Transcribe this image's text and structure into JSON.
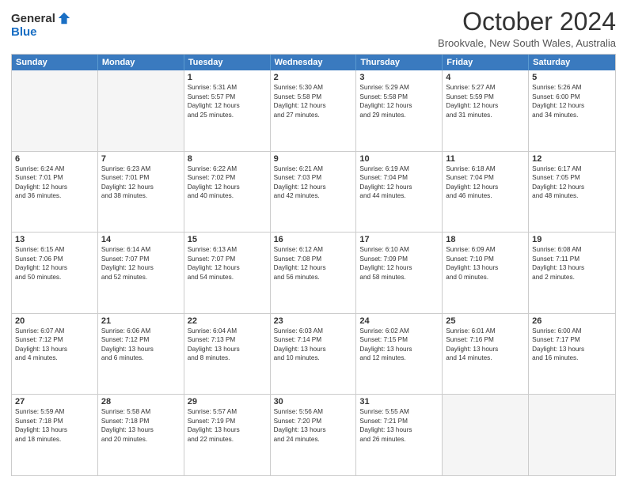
{
  "header": {
    "logo_general": "General",
    "logo_blue": "Blue",
    "title": "October 2024",
    "subtitle": "Brookvale, New South Wales, Australia"
  },
  "days_of_week": [
    "Sunday",
    "Monday",
    "Tuesday",
    "Wednesday",
    "Thursday",
    "Friday",
    "Saturday"
  ],
  "weeks": [
    [
      {
        "day": "",
        "lines": []
      },
      {
        "day": "",
        "lines": []
      },
      {
        "day": "1",
        "lines": [
          "Sunrise: 5:31 AM",
          "Sunset: 5:57 PM",
          "Daylight: 12 hours",
          "and 25 minutes."
        ]
      },
      {
        "day": "2",
        "lines": [
          "Sunrise: 5:30 AM",
          "Sunset: 5:58 PM",
          "Daylight: 12 hours",
          "and 27 minutes."
        ]
      },
      {
        "day": "3",
        "lines": [
          "Sunrise: 5:29 AM",
          "Sunset: 5:58 PM",
          "Daylight: 12 hours",
          "and 29 minutes."
        ]
      },
      {
        "day": "4",
        "lines": [
          "Sunrise: 5:27 AM",
          "Sunset: 5:59 PM",
          "Daylight: 12 hours",
          "and 31 minutes."
        ]
      },
      {
        "day": "5",
        "lines": [
          "Sunrise: 5:26 AM",
          "Sunset: 6:00 PM",
          "Daylight: 12 hours",
          "and 34 minutes."
        ]
      }
    ],
    [
      {
        "day": "6",
        "lines": [
          "Sunrise: 6:24 AM",
          "Sunset: 7:01 PM",
          "Daylight: 12 hours",
          "and 36 minutes."
        ]
      },
      {
        "day": "7",
        "lines": [
          "Sunrise: 6:23 AM",
          "Sunset: 7:01 PM",
          "Daylight: 12 hours",
          "and 38 minutes."
        ]
      },
      {
        "day": "8",
        "lines": [
          "Sunrise: 6:22 AM",
          "Sunset: 7:02 PM",
          "Daylight: 12 hours",
          "and 40 minutes."
        ]
      },
      {
        "day": "9",
        "lines": [
          "Sunrise: 6:21 AM",
          "Sunset: 7:03 PM",
          "Daylight: 12 hours",
          "and 42 minutes."
        ]
      },
      {
        "day": "10",
        "lines": [
          "Sunrise: 6:19 AM",
          "Sunset: 7:04 PM",
          "Daylight: 12 hours",
          "and 44 minutes."
        ]
      },
      {
        "day": "11",
        "lines": [
          "Sunrise: 6:18 AM",
          "Sunset: 7:04 PM",
          "Daylight: 12 hours",
          "and 46 minutes."
        ]
      },
      {
        "day": "12",
        "lines": [
          "Sunrise: 6:17 AM",
          "Sunset: 7:05 PM",
          "Daylight: 12 hours",
          "and 48 minutes."
        ]
      }
    ],
    [
      {
        "day": "13",
        "lines": [
          "Sunrise: 6:15 AM",
          "Sunset: 7:06 PM",
          "Daylight: 12 hours",
          "and 50 minutes."
        ]
      },
      {
        "day": "14",
        "lines": [
          "Sunrise: 6:14 AM",
          "Sunset: 7:07 PM",
          "Daylight: 12 hours",
          "and 52 minutes."
        ]
      },
      {
        "day": "15",
        "lines": [
          "Sunrise: 6:13 AM",
          "Sunset: 7:07 PM",
          "Daylight: 12 hours",
          "and 54 minutes."
        ]
      },
      {
        "day": "16",
        "lines": [
          "Sunrise: 6:12 AM",
          "Sunset: 7:08 PM",
          "Daylight: 12 hours",
          "and 56 minutes."
        ]
      },
      {
        "day": "17",
        "lines": [
          "Sunrise: 6:10 AM",
          "Sunset: 7:09 PM",
          "Daylight: 12 hours",
          "and 58 minutes."
        ]
      },
      {
        "day": "18",
        "lines": [
          "Sunrise: 6:09 AM",
          "Sunset: 7:10 PM",
          "Daylight: 13 hours",
          "and 0 minutes."
        ]
      },
      {
        "day": "19",
        "lines": [
          "Sunrise: 6:08 AM",
          "Sunset: 7:11 PM",
          "Daylight: 13 hours",
          "and 2 minutes."
        ]
      }
    ],
    [
      {
        "day": "20",
        "lines": [
          "Sunrise: 6:07 AM",
          "Sunset: 7:12 PM",
          "Daylight: 13 hours",
          "and 4 minutes."
        ]
      },
      {
        "day": "21",
        "lines": [
          "Sunrise: 6:06 AM",
          "Sunset: 7:12 PM",
          "Daylight: 13 hours",
          "and 6 minutes."
        ]
      },
      {
        "day": "22",
        "lines": [
          "Sunrise: 6:04 AM",
          "Sunset: 7:13 PM",
          "Daylight: 13 hours",
          "and 8 minutes."
        ]
      },
      {
        "day": "23",
        "lines": [
          "Sunrise: 6:03 AM",
          "Sunset: 7:14 PM",
          "Daylight: 13 hours",
          "and 10 minutes."
        ]
      },
      {
        "day": "24",
        "lines": [
          "Sunrise: 6:02 AM",
          "Sunset: 7:15 PM",
          "Daylight: 13 hours",
          "and 12 minutes."
        ]
      },
      {
        "day": "25",
        "lines": [
          "Sunrise: 6:01 AM",
          "Sunset: 7:16 PM",
          "Daylight: 13 hours",
          "and 14 minutes."
        ]
      },
      {
        "day": "26",
        "lines": [
          "Sunrise: 6:00 AM",
          "Sunset: 7:17 PM",
          "Daylight: 13 hours",
          "and 16 minutes."
        ]
      }
    ],
    [
      {
        "day": "27",
        "lines": [
          "Sunrise: 5:59 AM",
          "Sunset: 7:18 PM",
          "Daylight: 13 hours",
          "and 18 minutes."
        ]
      },
      {
        "day": "28",
        "lines": [
          "Sunrise: 5:58 AM",
          "Sunset: 7:18 PM",
          "Daylight: 13 hours",
          "and 20 minutes."
        ]
      },
      {
        "day": "29",
        "lines": [
          "Sunrise: 5:57 AM",
          "Sunset: 7:19 PM",
          "Daylight: 13 hours",
          "and 22 minutes."
        ]
      },
      {
        "day": "30",
        "lines": [
          "Sunrise: 5:56 AM",
          "Sunset: 7:20 PM",
          "Daylight: 13 hours",
          "and 24 minutes."
        ]
      },
      {
        "day": "31",
        "lines": [
          "Sunrise: 5:55 AM",
          "Sunset: 7:21 PM",
          "Daylight: 13 hours",
          "and 26 minutes."
        ]
      },
      {
        "day": "",
        "lines": []
      },
      {
        "day": "",
        "lines": []
      }
    ]
  ]
}
